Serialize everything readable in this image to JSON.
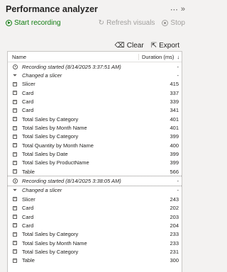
{
  "pane": {
    "title": "Performance analyzer",
    "more_icon": "ellipsis-icon",
    "collapse_icon": "double-chevron-right-icon"
  },
  "toolbar": {
    "start_label": "Start recording",
    "refresh_label": "Refresh visuals",
    "stop_label": "Stop"
  },
  "actions": {
    "clear_label": "Clear",
    "export_label": "Export"
  },
  "table": {
    "col_name": "Name",
    "col_duration": "Duration (ms)",
    "rows": [
      {
        "icon": "clock",
        "name": "Recording started (8/14/2025 3:37:51 AM)",
        "duration": "-",
        "italic": true
      },
      {
        "icon": "filter",
        "name": "Changed a slicer",
        "duration": "-",
        "italic": true
      },
      {
        "icon": "expand",
        "name": "Slicer",
        "duration": "415"
      },
      {
        "icon": "expand",
        "name": "Card",
        "duration": "337"
      },
      {
        "icon": "expand",
        "name": "Card",
        "duration": "339"
      },
      {
        "icon": "expand",
        "name": "Card",
        "duration": "341"
      },
      {
        "icon": "expand",
        "name": "Total Sales by Category",
        "duration": "401"
      },
      {
        "icon": "expand",
        "name": "Total Sales by Month Name",
        "duration": "401"
      },
      {
        "icon": "expand",
        "name": "Total Sales by Category",
        "duration": "399"
      },
      {
        "icon": "expand",
        "name": "Total Quantity by Month Name",
        "duration": "400"
      },
      {
        "icon": "expand",
        "name": "Total Sales by Date",
        "duration": "399"
      },
      {
        "icon": "expand",
        "name": "Total Sales by ProductName",
        "duration": "399"
      },
      {
        "icon": "expand",
        "name": "Table",
        "duration": "566"
      },
      {
        "icon": "clock",
        "name": "Recording started (8/14/2025 3:38:05 AM)",
        "duration": "-",
        "italic": true,
        "separator": true
      },
      {
        "icon": "filter",
        "name": "Changed a slicer",
        "duration": "-",
        "italic": true,
        "separator": true
      },
      {
        "icon": "expand",
        "name": "Slicer",
        "duration": "243"
      },
      {
        "icon": "expand",
        "name": "Card",
        "duration": "202"
      },
      {
        "icon": "expand",
        "name": "Card",
        "duration": "203"
      },
      {
        "icon": "expand",
        "name": "Card",
        "duration": "204"
      },
      {
        "icon": "expand",
        "name": "Total Sales by Category",
        "duration": "233"
      },
      {
        "icon": "expand",
        "name": "Total Sales by Month Name",
        "duration": "233"
      },
      {
        "icon": "expand",
        "name": "Total Sales by Category",
        "duration": "231"
      },
      {
        "icon": "expand",
        "name": "Table",
        "duration": "300"
      }
    ]
  }
}
